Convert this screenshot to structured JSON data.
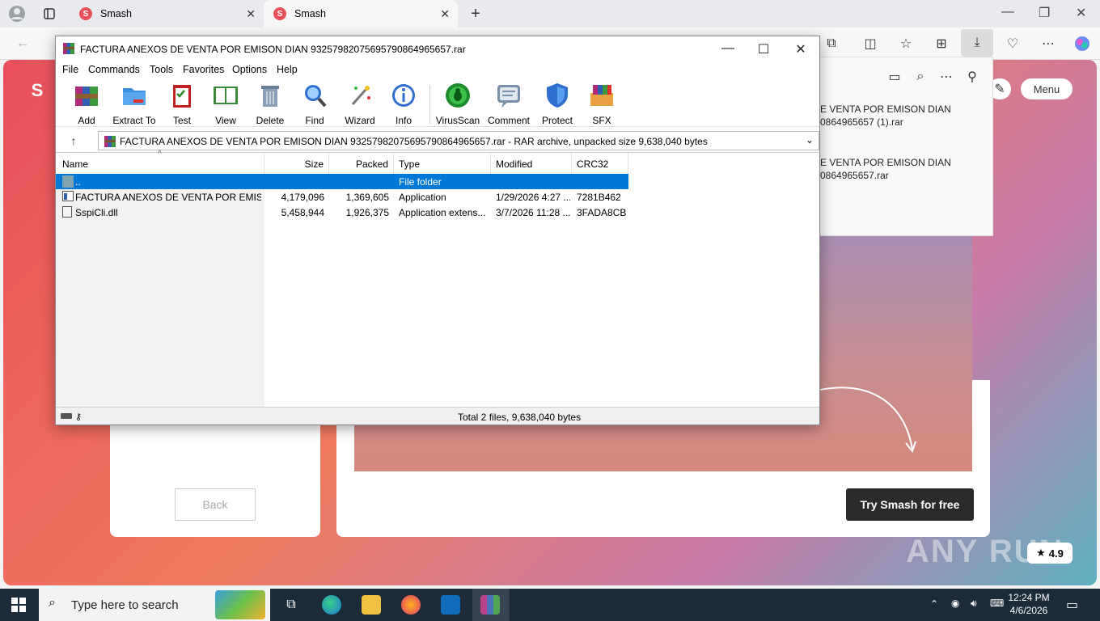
{
  "browser": {
    "tabs": [
      {
        "title": "Smash"
      },
      {
        "title": "Smash"
      }
    ],
    "new_tab": "+"
  },
  "page": {
    "menu_label": "Menu",
    "back_label": "Back",
    "try_label": "Try Smash for free",
    "rating": "4.9",
    "watermark": "ANY RUN"
  },
  "downloads": {
    "items": [
      {
        "line1": "E VENTA POR EMISON DIAN",
        "line2": "0864965657 (1).rar"
      },
      {
        "line1": "E VENTA POR EMISON DIAN",
        "line2": "0864965657.rar"
      }
    ]
  },
  "rar": {
    "title": "FACTURA ANEXOS DE VENTA POR EMISON DIAN 93257982075695790864965657.rar",
    "menu": [
      "File",
      "Commands",
      "Tools",
      "Favorites",
      "Options",
      "Help"
    ],
    "toolbar": [
      "Add",
      "Extract To",
      "Test",
      "View",
      "Delete",
      "Find",
      "Wizard",
      "Info",
      "VirusScan",
      "Comment",
      "Protect",
      "SFX"
    ],
    "path": "FACTURA ANEXOS DE VENTA POR EMISON DIAN 93257982075695790864965657.rar - RAR archive, unpacked size 9,638,040 bytes",
    "columns": [
      "Name",
      "Size",
      "Packed",
      "Type",
      "Modified",
      "CRC32"
    ],
    "rows": [
      {
        "name": "..",
        "size": "",
        "packed": "",
        "type": "File folder",
        "modified": "",
        "crc": ""
      },
      {
        "name": "FACTURA ANEXOS DE VENTA POR EMISO...",
        "size": "4,179,096",
        "packed": "1,369,605",
        "type": "Application",
        "modified": "1/29/2026 4:27 ...",
        "crc": "7281B462"
      },
      {
        "name": "SspiCli.dll",
        "size": "5,458,944",
        "packed": "1,926,375",
        "type": "Application extens...",
        "modified": "3/7/2026 11:28 ...",
        "crc": "3FADA8CB"
      }
    ],
    "status": "Total 2 files, 9,638,040 bytes"
  },
  "taskbar": {
    "search_placeholder": "Type here to search",
    "time": "12:24 PM",
    "date": "4/6/2026"
  }
}
